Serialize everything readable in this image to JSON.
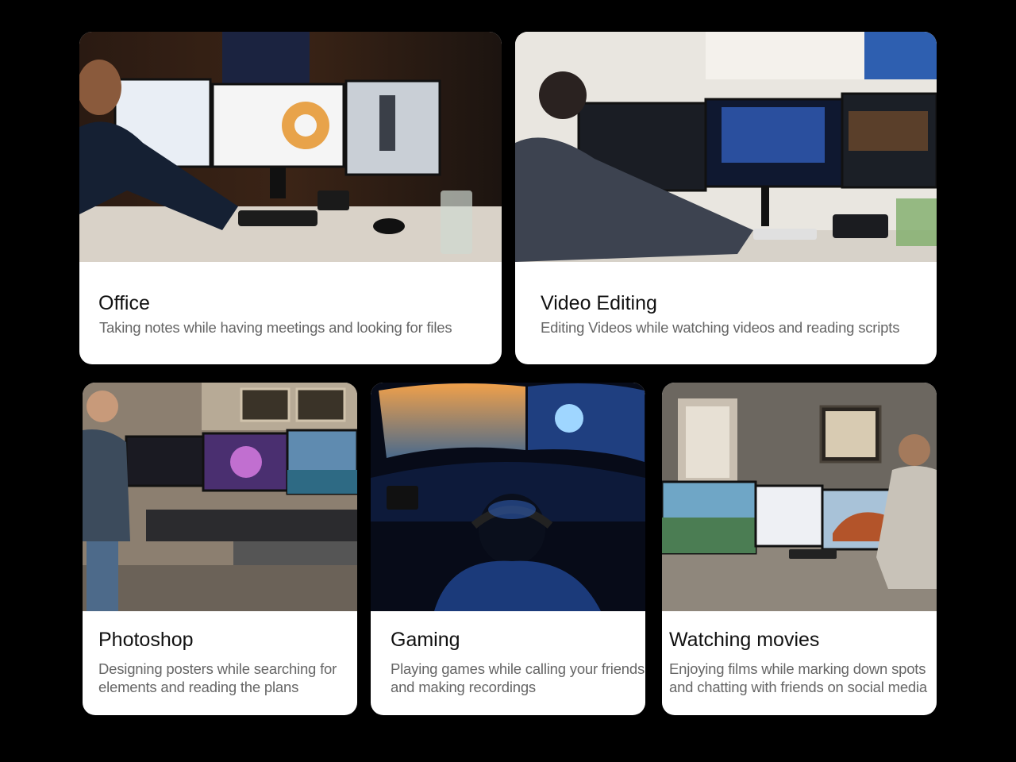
{
  "cards": [
    {
      "id": "office",
      "title": "Office",
      "description": "Taking notes while having meetings and looking for files",
      "image": "office-workstation-photo"
    },
    {
      "id": "video",
      "title": "Video Editing",
      "description": "Editing Videos while watching videos and reading scripts",
      "image": "video-editing-photo"
    },
    {
      "id": "photoshop",
      "title": "Photoshop",
      "description": "Designing posters while searching for elements and reading the plans",
      "image": "photoshop-studio-photo"
    },
    {
      "id": "gaming",
      "title": "Gaming",
      "description": "Playing games while calling your friends and making recordings",
      "image": "gaming-setup-photo"
    },
    {
      "id": "movies",
      "title": "Watching movies",
      "description": "Enjoying films while marking down spots and chatting with friends on social media",
      "image": "home-office-movies-photo"
    }
  ],
  "colors": {
    "page_background": "#000000",
    "card_background": "#ffffff",
    "title": "#111111",
    "description": "#666666"
  }
}
